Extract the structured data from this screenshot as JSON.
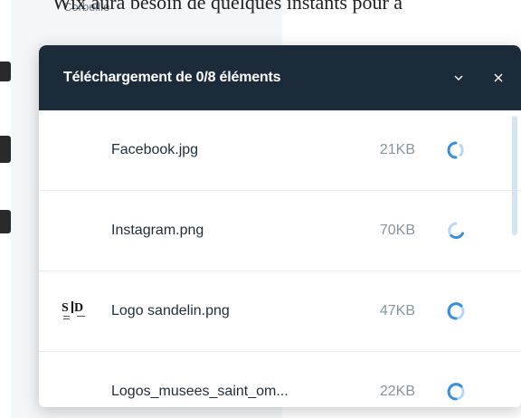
{
  "background": {
    "top_text": "Wix aura besoin de quelques instants pour a",
    "sidebar_item": "Corbeille"
  },
  "panel": {
    "title": "Téléchargement de 0/8 éléments",
    "collapse_icon": "chevron-down-icon",
    "close_icon": "close-icon"
  },
  "files": [
    {
      "name": "Facebook.jpg",
      "size": "21KB",
      "thumbnail": false,
      "status_icon": "spinner-icon"
    },
    {
      "name": "Instagram.png",
      "size": "70KB",
      "thumbnail": false,
      "status_icon": "spinner-icon"
    },
    {
      "name": "Logo sandelin.png",
      "size": "47KB",
      "thumbnail": true,
      "status_icon": "spinner-icon"
    },
    {
      "name": "Logos_musees_saint_om...",
      "size": "22KB",
      "thumbnail": false,
      "status_icon": "spinner-icon"
    }
  ],
  "colors": {
    "header_bg": "#1c2b3a",
    "spinner": "#3b8fd9",
    "scrollbar": "#d6e4ef"
  }
}
